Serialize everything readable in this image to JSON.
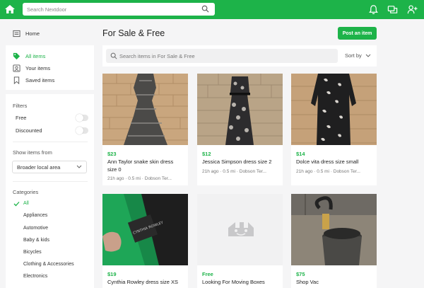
{
  "header": {
    "search_placeholder": "Search Nextdoor",
    "icons": [
      "nextdoor-logo-icon",
      "search-icon",
      "bell-icon",
      "chat-icon",
      "add-person-icon"
    ],
    "brand_color": "#1db349"
  },
  "sidebar": {
    "home": "Home",
    "items": [
      {
        "label": "All items",
        "active": true
      },
      {
        "label": "Your items",
        "active": false
      },
      {
        "label": "Saved items",
        "active": false
      }
    ],
    "filters_title": "Filters",
    "filters": [
      {
        "label": "Free",
        "on": false
      },
      {
        "label": "Discounted",
        "on": false
      }
    ],
    "show_items_from": "Show items from",
    "area_select": "Broader local area",
    "categories_title": "Categories",
    "categories": [
      "All",
      "Appliances",
      "Automotive",
      "Baby & kids",
      "Bicycles",
      "Clothing & Accessories",
      "Electronics"
    ],
    "selected_category": "All"
  },
  "main": {
    "title": "For Sale & Free",
    "post_button": "Post an item",
    "search_placeholder": "Search items in For Sale & Free",
    "sort_label": "Sort by",
    "listings": [
      {
        "price": "$23",
        "title": "Ann Taylor snake skin dress size 0",
        "meta": "21h ago · 0.5 mi · Dobson Ter..."
      },
      {
        "price": "$12",
        "title": "Jessica Simpson dress size 2",
        "meta": "21h ago · 0.5 mi · Dobson Ter..."
      },
      {
        "price": "$14",
        "title": "Dolce vita dress size small",
        "meta": "21h ago · 0.5 mi · Dobson Ter..."
      },
      {
        "price": "$19",
        "title": "Cynthia Rowley dress size XS",
        "meta": ""
      },
      {
        "price": "Free",
        "title": "Looking For Moving Boxes",
        "meta": ""
      },
      {
        "price": "$75",
        "title": "Shop Vac",
        "meta": ""
      }
    ]
  }
}
